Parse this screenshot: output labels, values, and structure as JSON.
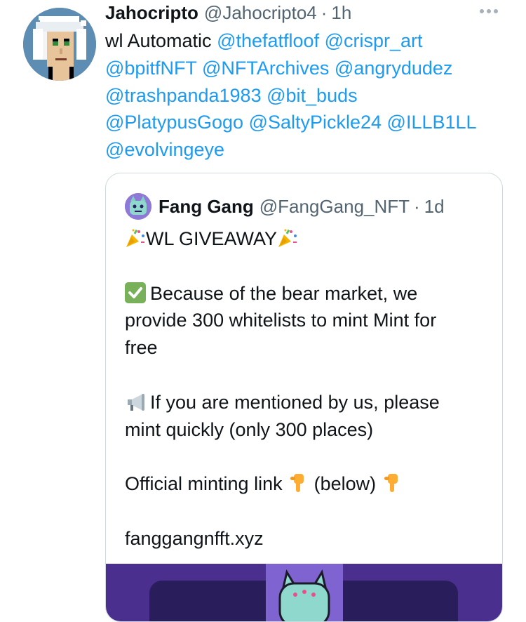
{
  "tweet": {
    "author_name": "Jahocripto",
    "author_handle": "@Jahocripto4",
    "separator": "·",
    "time": "1h",
    "text_prefix": "wl Automatic",
    "mentions": [
      "@thefatfloof",
      "@crispr_art",
      "@bpitfNFT",
      "@NFTArchives",
      "@angrydudez",
      "@trashpanda1983",
      "@bit_buds",
      "@PlatypusGogo",
      "@SaltyPickle24",
      "@ILLB1LL",
      "@evolvingeye"
    ]
  },
  "quote": {
    "author_name": "Fang Gang",
    "author_handle": "@FangGang_NFT",
    "separator": "·",
    "time": "1d",
    "line_giveaway": "WL GIVEAWAY",
    "line_bear_1": "Because of the bear market, we",
    "line_bear_2": "provide 300 whitelists to mint Mint for",
    "line_bear_3": "free",
    "line_mention_1": "If you are mentioned by us, please",
    "line_mention_2": "mint quickly (only 300 places)",
    "line_link_a": "Official minting link",
    "line_link_b": "(below)",
    "link": "fanggangnfft.xyz"
  },
  "icons": {
    "more": "more-icon",
    "party": "party-popper-icon",
    "check": "check-mark-button-icon",
    "megaphone": "megaphone-icon",
    "point_down": "backhand-index-pointing-down-icon"
  },
  "colors": {
    "link": "#1d9bf0",
    "secondary_text": "#536471",
    "media_bg": "#4a2f8f"
  }
}
